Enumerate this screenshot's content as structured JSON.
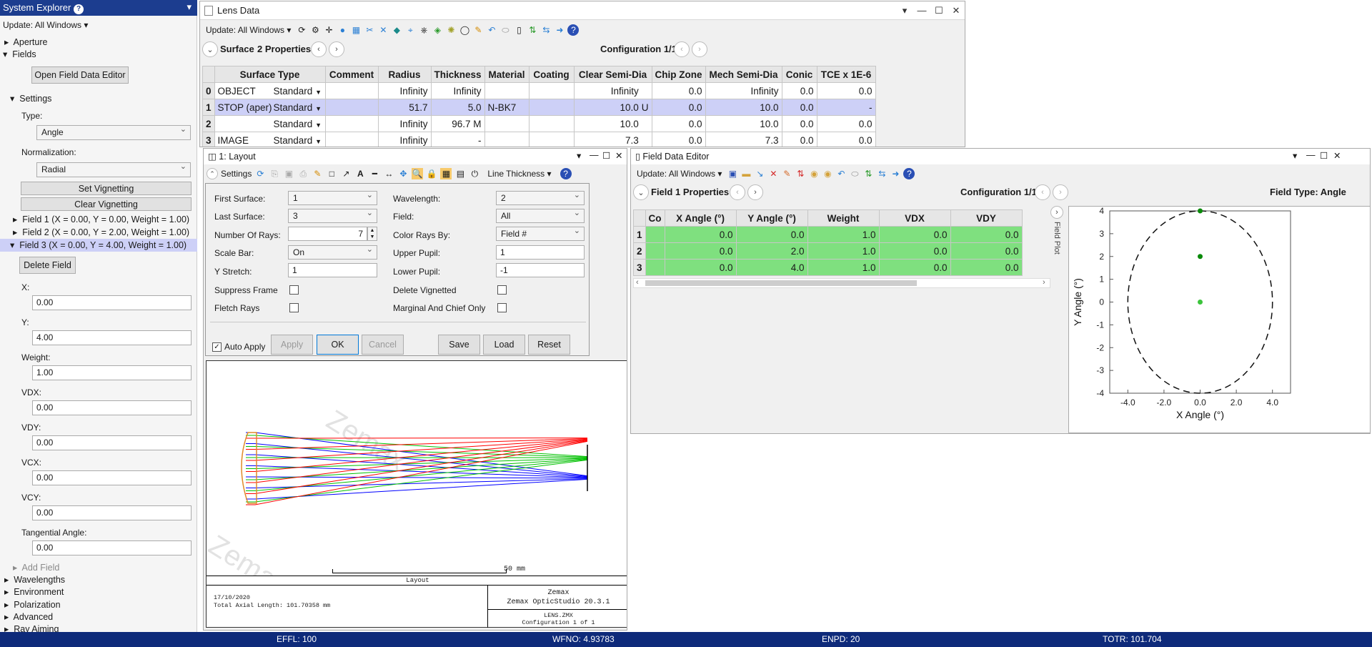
{
  "sys": {
    "title": "System Explorer",
    "update": "Update: All Windows",
    "aperture": "Aperture",
    "fields": "Fields",
    "open_editor": "Open Field Data Editor",
    "settings": "Settings",
    "type_label": "Type:",
    "type_value": "Angle",
    "norm_label": "Normalization:",
    "norm_value": "Radial",
    "set_vig": "Set Vignetting",
    "clear_vig": "Clear Vignetting",
    "field_items": [
      "Field 1 (X = 0.00, Y = 0.00, Weight = 1.00)",
      "Field 2 (X = 0.00, Y = 2.00, Weight = 1.00)",
      "Field 3 (X = 0.00, Y = 4.00, Weight = 1.00)"
    ],
    "delete_field": "Delete Field",
    "props": [
      {
        "label": "X:",
        "value": "0.00"
      },
      {
        "label": "Y:",
        "value": "4.00"
      },
      {
        "label": "Weight:",
        "value": "1.00"
      },
      {
        "label": "VDX:",
        "value": "0.00"
      },
      {
        "label": "VDY:",
        "value": "0.00"
      },
      {
        "label": "VCX:",
        "value": "0.00"
      },
      {
        "label": "VCY:",
        "value": "0.00"
      },
      {
        "label": "Tangential Angle:",
        "value": "0.00"
      }
    ],
    "add_field": "Add Field",
    "bottom": [
      "Wavelengths",
      "Environment",
      "Polarization",
      "Advanced",
      "Ray Aiming"
    ]
  },
  "lens": {
    "title": "Lens Data",
    "update": "Update: All Windows",
    "surface": "Surface",
    "props": "2 Properties",
    "config": "Configuration 1/1",
    "headers": [
      "",
      "Surface Type",
      "Comment",
      "Radius",
      "Thickness",
      "Material",
      "Coating",
      "Clear Semi-Dia",
      "Chip Zone",
      "Mech Semi-Dia",
      "Conic",
      "TCE x 1E-6"
    ],
    "rows": [
      [
        "0",
        "OBJECT",
        "Standard",
        "",
        "Infinity",
        "Infinity",
        "",
        "",
        "Infinity",
        "",
        "0.0",
        "Infinity",
        "0.0",
        "0.0"
      ],
      [
        "1",
        "STOP (aper)",
        "Standard",
        "",
        "51.7",
        "5.0",
        "N-BK7",
        "",
        "10.0",
        "U",
        "0.0",
        "10.0",
        "0.0",
        "-"
      ],
      [
        "2",
        "",
        "Standard",
        "",
        "Infinity",
        "96.7",
        "",
        "",
        "10.0",
        "",
        "0.0",
        "10.0",
        "0.0",
        "0.0"
      ],
      [
        "3",
        "IMAGE",
        "Standard",
        "",
        "Infinity",
        "-",
        "",
        "",
        "7.3",
        "",
        "0.0",
        "7.3",
        "0.0",
        "0.0"
      ]
    ],
    "thick_solve": "M"
  },
  "layout": {
    "title": "1: Layout",
    "settings": "Settings",
    "line_thickness": "Line Thickness",
    "first_surface_label": "First Surface:",
    "first_surface": "1",
    "last_surface_label": "Last Surface:",
    "last_surface": "3",
    "rays_label": "Number Of Rays:",
    "rays": "7",
    "scale_label": "Scale Bar:",
    "scale": "On",
    "ystretch_label": "Y Stretch:",
    "ystretch": "1",
    "suppress": "Suppress Frame",
    "fletch": "Fletch Rays",
    "wave_label": "Wavelength:",
    "wave": "2",
    "field_label": "Field:",
    "field": "All",
    "color_label": "Color Rays By:",
    "color": "Field #",
    "upper_label": "Upper Pupil:",
    "upper": "1",
    "lower_label": "Lower Pupil:",
    "lower": "-1",
    "delete_vig": "Delete Vignetted",
    "marginal": "Marginal And Chief Only",
    "auto_apply": "Auto Apply",
    "apply": "Apply",
    "ok": "OK",
    "cancel": "Cancel",
    "save": "Save",
    "load": "Load",
    "reset": "Reset",
    "scale_text": "50 mm",
    "plot_label": "Layout",
    "date": "17/10/2020",
    "axial": "Total Axial Length:  101.70358 mm",
    "brand": "Zemax",
    "product": "Zemax OpticStudio 20.3.1",
    "file": "LENS.ZMX",
    "cfg": "Configuration 1 of 1",
    "watermark": "Zemax"
  },
  "fde": {
    "title": "Field Data Editor",
    "update": "Update: All Windows",
    "field": "Field",
    "props": "1 Properties",
    "config": "Configuration 1/1",
    "type": "Field Type: Angle",
    "headers": [
      "",
      "Co",
      "X Angle (°)",
      "Y Angle (°)",
      "Weight",
      "VDX",
      "VDY"
    ],
    "rows": [
      [
        "1",
        "",
        "0.0",
        "0.0",
        "1.0",
        "0.0",
        "0.0"
      ],
      [
        "2",
        "",
        "0.0",
        "2.0",
        "1.0",
        "0.0",
        "0.0"
      ],
      [
        "3",
        "",
        "0.0",
        "4.0",
        "1.0",
        "0.0",
        "0.0"
      ]
    ],
    "side_tab": "Field Plot"
  },
  "chart_data": {
    "type": "scatter",
    "xlabel": "X Angle (°)",
    "ylabel": "Y Angle (°)",
    "xlim": [
      -5,
      5
    ],
    "ylim": [
      -4,
      4
    ],
    "xticks": [
      "-4.0",
      "-2.0",
      "0.0",
      "2.0",
      "4.0"
    ],
    "yticks": [
      "4",
      "3",
      "2",
      "1",
      "0",
      "-1",
      "-2",
      "-3",
      "-4"
    ],
    "points": [
      {
        "x": 0,
        "y": 0
      },
      {
        "x": 0,
        "y": 2
      },
      {
        "x": 0,
        "y": 4
      }
    ],
    "circle_radius": 4,
    "colors": [
      "#3cc43c",
      "#0a8a0a",
      "#0a8a0a"
    ]
  },
  "status": {
    "effl": "EFFL: 100",
    "wfno": "WFNO: 4.93783",
    "enpd": "ENPD: 20",
    "totr": "TOTR: 101.704"
  },
  "colors": {
    "status_bar": "#0e2a7a",
    "sidebar_header": "#1c3d8f",
    "selection": "#cdd0f7",
    "green_row": "#7fe07f",
    "ray_red": "#ff0000",
    "ray_green": "#00c000",
    "ray_blue": "#0000ff"
  }
}
